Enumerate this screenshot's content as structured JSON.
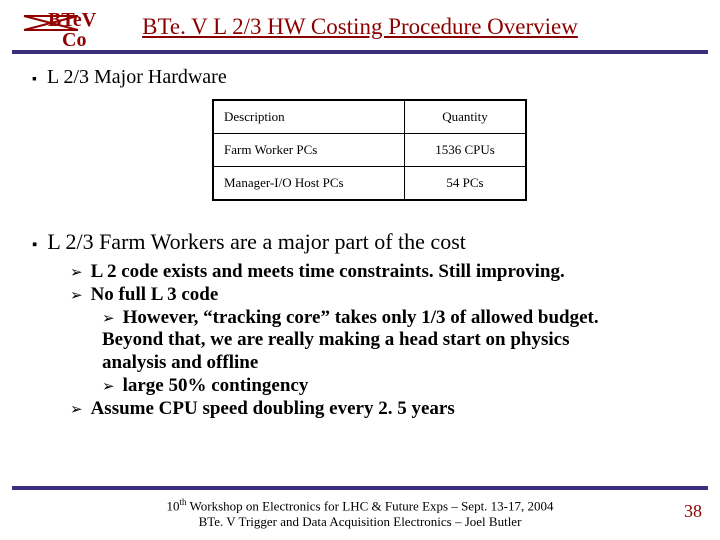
{
  "title": "BTe. V L 2/3 HW Costing Procedure Overview",
  "logo": {
    "top": "BTeV",
    "bottom": "Co"
  },
  "bullets": {
    "major_hw": "L 2/3 Major Hardware",
    "farm_workers": "L 2/3 Farm Workers are a major part of the cost"
  },
  "table": {
    "header": {
      "desc": "Description",
      "qty": "Quantity"
    },
    "rows": [
      {
        "desc": "Farm Worker PCs",
        "qty": "1536 CPUs"
      },
      {
        "desc": "Manager-I/O Host PCs",
        "qty": "54 PCs"
      }
    ]
  },
  "sub": {
    "a": "L 2 code exists and meets time constraints. Still improving.",
    "b": "No full L 3 code",
    "b1a": "However, “tracking core” takes only 1/3 of allowed budget.",
    "b1b": "Beyond that, we are really making a head start on physics",
    "b1c": "analysis and offline",
    "b2": "large 50% contingency",
    "c": "Assume CPU speed doubling every 2. 5 years"
  },
  "footer": {
    "line1_pre": "10",
    "line1_sup": "th",
    "line1_rest": " Workshop on Electronics for LHC & Future Exps – Sept. 13-17, 2004",
    "line2": "BTe. V Trigger and Data Acquisition Electronics – Joel Butler"
  },
  "page": "38"
}
